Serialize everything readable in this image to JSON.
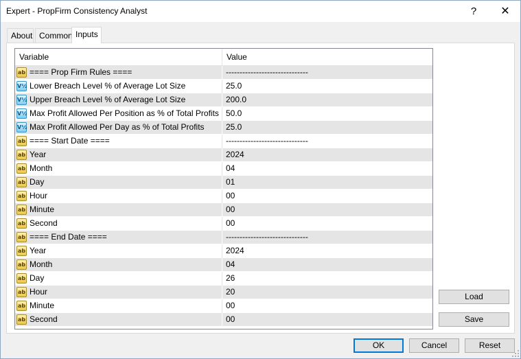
{
  "window": {
    "title": "Expert - PropFirm Consistency Analyst",
    "help_label": "?",
    "close_label": "✕"
  },
  "tabs": [
    {
      "label": "About"
    },
    {
      "label": "Common"
    },
    {
      "label": "Inputs"
    }
  ],
  "grid": {
    "col_variable": "Variable",
    "col_value": "Value",
    "rows": [
      {
        "icon": "ab",
        "name": "==== Prop Firm Rules ====",
        "value": "------------------------------"
      },
      {
        "icon": "val",
        "name": "Lower Breach Level % of Average Lot Size",
        "value": "25.0"
      },
      {
        "icon": "val",
        "name": "Upper Breach Level % of Average Lot Size",
        "value": "200.0"
      },
      {
        "icon": "val",
        "name": "Max Profit Allowed Per Position as % of Total Profits",
        "value": "50.0"
      },
      {
        "icon": "val",
        "name": "Max Profit Allowed Per Day as % of Total Profits",
        "value": "25.0"
      },
      {
        "icon": "ab",
        "name": "==== Start Date ====",
        "value": "------------------------------"
      },
      {
        "icon": "ab",
        "name": "Year",
        "value": "2024"
      },
      {
        "icon": "ab",
        "name": "Month",
        "value": "04"
      },
      {
        "icon": "ab",
        "name": "Day",
        "value": "01"
      },
      {
        "icon": "ab",
        "name": "Hour",
        "value": "00"
      },
      {
        "icon": "ab",
        "name": "Minute",
        "value": "00"
      },
      {
        "icon": "ab",
        "name": "Second",
        "value": "00"
      },
      {
        "icon": "ab",
        "name": "==== End Date ====",
        "value": "------------------------------"
      },
      {
        "icon": "ab",
        "name": "Year",
        "value": "2024"
      },
      {
        "icon": "ab",
        "name": "Month",
        "value": "04"
      },
      {
        "icon": "ab",
        "name": "Day",
        "value": "26"
      },
      {
        "icon": "ab",
        "name": "Hour",
        "value": "20"
      },
      {
        "icon": "ab",
        "name": "Minute",
        "value": "00"
      },
      {
        "icon": "ab",
        "name": "Second",
        "value": "00"
      }
    ]
  },
  "icons": {
    "ab": {
      "name": "string-type-icon",
      "glyph": "ab"
    },
    "val": {
      "name": "double-type-icon",
      "glyph": "V½"
    }
  },
  "buttons": {
    "load": "Load",
    "save": "Save",
    "ok": "OK",
    "cancel": "Cancel",
    "reset": "Reset"
  },
  "colors": {
    "accent": "#0078d7",
    "alt_row": "#e5e5e5"
  }
}
